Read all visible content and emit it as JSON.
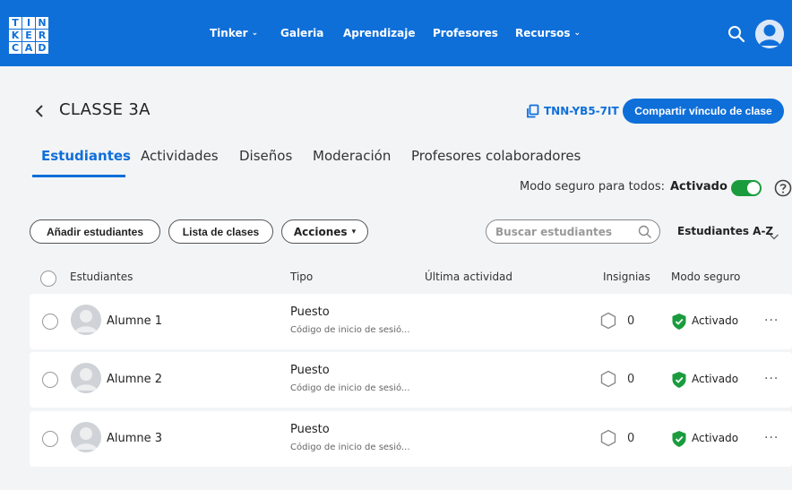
{
  "brand": {
    "logo_letters": [
      "T",
      "I",
      "N",
      "K",
      "E",
      "R",
      "C",
      "A",
      "D"
    ]
  },
  "nav": {
    "items": [
      {
        "label": "Tinker",
        "has_dropdown": true
      },
      {
        "label": "Galeria",
        "has_dropdown": false
      },
      {
        "label": "Aprendizaje",
        "has_dropdown": false
      },
      {
        "label": "Profesores",
        "has_dropdown": false
      },
      {
        "label": "Recursos",
        "has_dropdown": true
      }
    ],
    "caret": "⌄"
  },
  "header": {
    "back_icon": "chevron-left-icon",
    "title": "CLASSE 3A",
    "class_code": "TNN-YB5-7IT",
    "share_label": "Compartir vínculo de clase"
  },
  "tabs": [
    {
      "label": "Estudiantes",
      "active": true
    },
    {
      "label": "Actividades",
      "active": false
    },
    {
      "label": "Diseños",
      "active": false
    },
    {
      "label": "Moderación",
      "active": false
    },
    {
      "label": "Profesores colaboradores",
      "active": false
    }
  ],
  "safe_mode": {
    "label": "Modo seguro para todos:",
    "value": "Activado",
    "enabled": true
  },
  "actions": {
    "add_students": "Añadir estudiantes",
    "class_list": "Lista de clases",
    "actions_label": "Acciones",
    "actions_caret": "▾",
    "search_placeholder": "Buscar estudiantes",
    "sort_label": "Estudiantes A-Z"
  },
  "table": {
    "columns": [
      "Estudiantes",
      "Tipo",
      "Última actividad",
      "Insignias",
      "Modo seguro"
    ],
    "rows": [
      {
        "name": "Alumne 1",
        "type": "Puesto",
        "type_sub": "Código de inicio de sesió...",
        "last_activity": "",
        "badges": "0",
        "safe_mode": "Activado"
      },
      {
        "name": "Alumne 2",
        "type": "Puesto",
        "type_sub": "Código de inicio de sesió...",
        "last_activity": "",
        "badges": "0",
        "safe_mode": "Activado"
      },
      {
        "name": "Alumne 3",
        "type": "Puesto",
        "type_sub": "Código de inicio de sesió...",
        "last_activity": "",
        "badges": "0",
        "safe_mode": "Activado"
      }
    ],
    "more_label": "···"
  },
  "colors": {
    "primary": "#0f6fd9",
    "success": "#1a9c3e",
    "background": "#f3f4f6"
  }
}
